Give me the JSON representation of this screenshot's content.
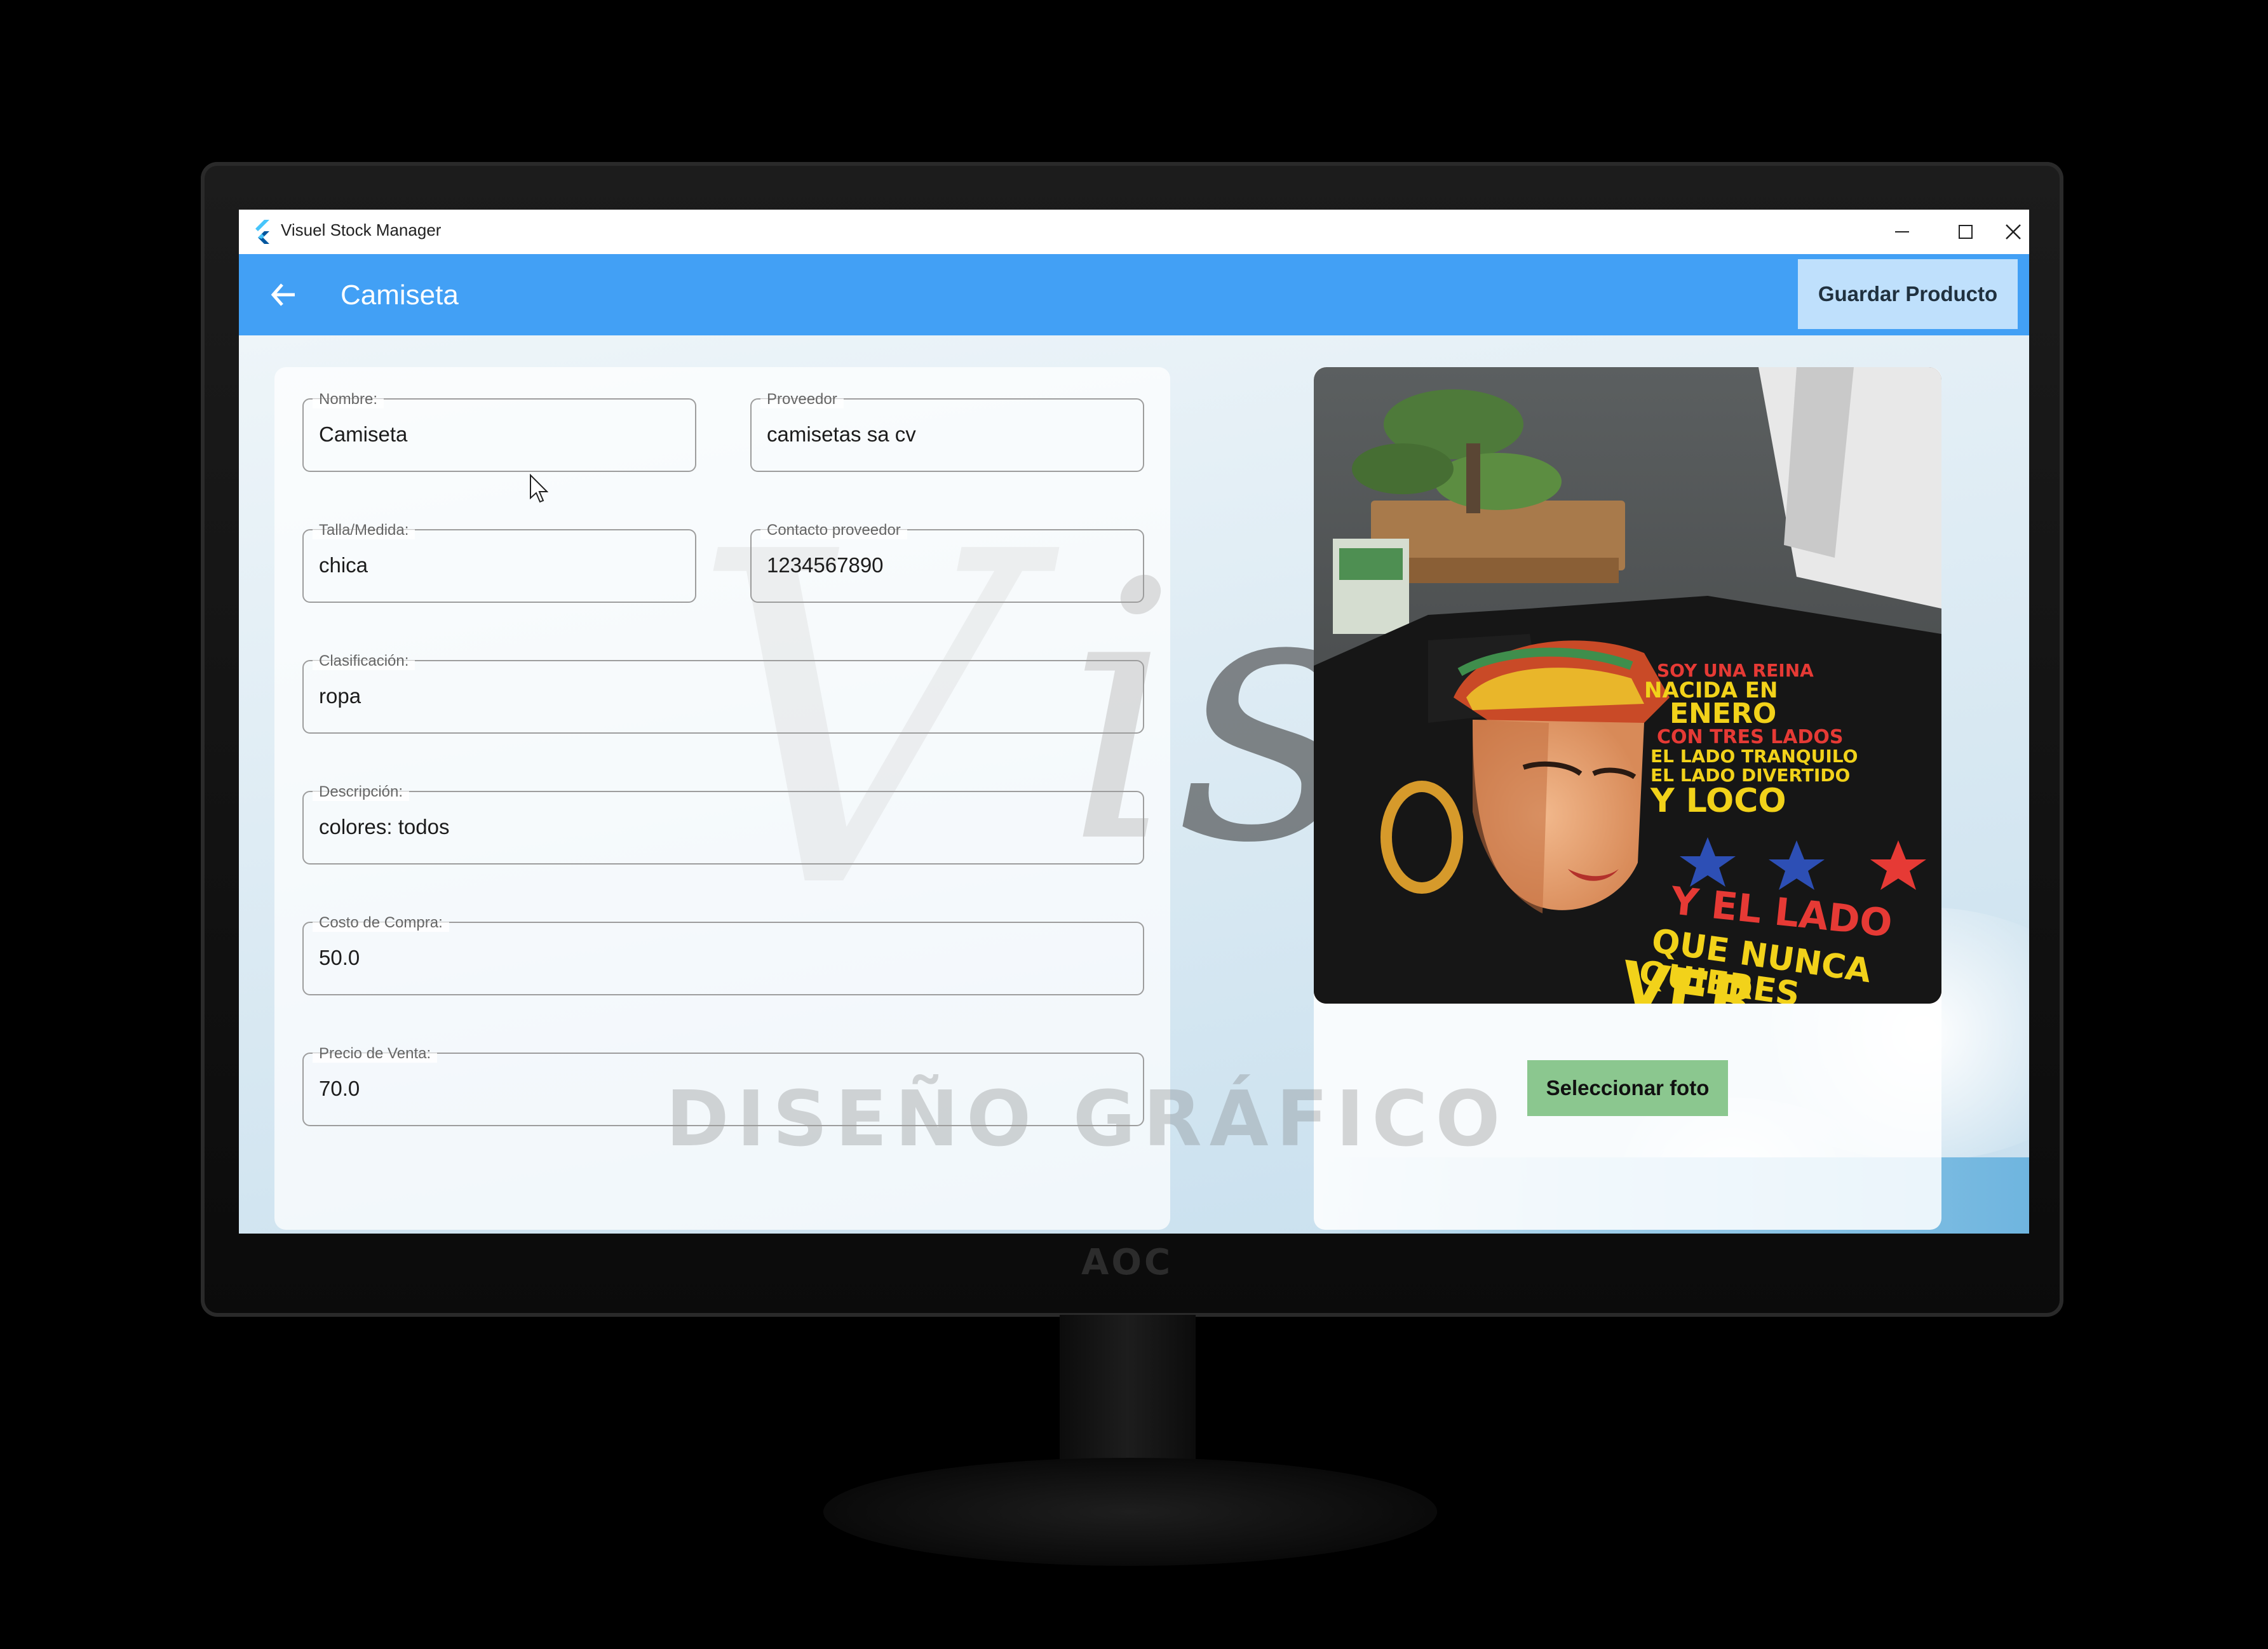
{
  "window": {
    "title": "Visuel Stock Manager"
  },
  "appbar": {
    "title": "Camiseta",
    "save_label": "Guardar Producto"
  },
  "form": {
    "fields": [
      {
        "label": "Nombre:",
        "value": "Camiseta"
      },
      {
        "label": "Proveedor",
        "value": "camisetas sa cv"
      },
      {
        "label": "Talla/Medida:",
        "value": "chica"
      },
      {
        "label": "Contacto proveedor",
        "value": "1234567890"
      },
      {
        "label": "Clasificación:",
        "value": "ropa"
      },
      {
        "label": "Descripción:",
        "value": "colores: todos"
      },
      {
        "label": "Costo de Compra:",
        "value": "50.0"
      },
      {
        "label": "Precio de Venta:",
        "value": "70.0"
      }
    ]
  },
  "photo": {
    "select_label": "Seleccionar foto",
    "shirt_text": [
      "SOY UNA REINA",
      "NACIDA EN",
      "ENERO",
      "CON TRES LADOS",
      "EL LADO TRANQUILO",
      "EL LADO DIVERTIDO",
      "Y LOCO",
      "Y EL LADO",
      "QUE NUNCA",
      "QUIERES",
      "VER"
    ]
  },
  "background": {
    "logo_text": "DISEÑO GRÁFICO"
  },
  "monitor": {
    "brand": "AOC"
  },
  "colors": {
    "appbar": "#42a0f5",
    "save_button": "#bfe0fc",
    "select_button": "#8bc78f"
  }
}
